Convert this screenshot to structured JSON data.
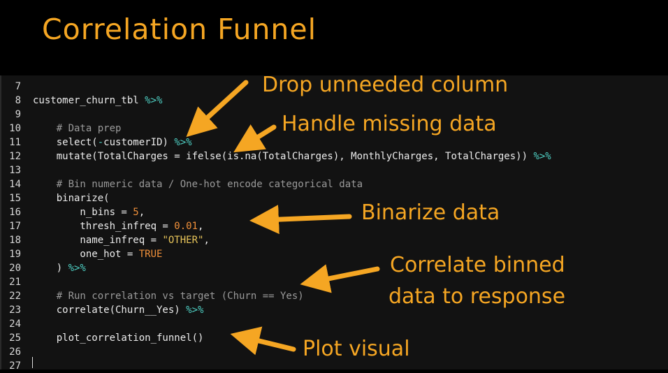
{
  "title": "Correlation Funnel",
  "code_lines": [
    {
      "n": "7",
      "seg": []
    },
    {
      "n": "8",
      "seg": [
        [
          "customer_churn_tbl ",
          ""
        ],
        [
          "%>%",
          "op"
        ]
      ]
    },
    {
      "n": "9",
      "seg": []
    },
    {
      "n": "10",
      "seg": [
        [
          "    # Data prep",
          "cm"
        ]
      ]
    },
    {
      "n": "11",
      "seg": [
        [
          "    select(",
          ""
        ],
        [
          "-",
          "op"
        ],
        [
          "customerID) ",
          ""
        ],
        [
          "%>%",
          "op"
        ]
      ]
    },
    {
      "n": "12",
      "seg": [
        [
          "    mutate(TotalCharges = ifelse(is.na(TotalCharges), MonthlyCharges, TotalCharges)) ",
          ""
        ],
        [
          "%>%",
          "op"
        ]
      ]
    },
    {
      "n": "13",
      "seg": []
    },
    {
      "n": "14",
      "seg": [
        [
          "    # Bin numeric data / One-hot encode categorical data",
          "cm"
        ]
      ]
    },
    {
      "n": "15",
      "seg": [
        [
          "    binarize(",
          ""
        ]
      ]
    },
    {
      "n": "16",
      "seg": [
        [
          "        n_bins = ",
          ""
        ],
        [
          "5",
          "num"
        ],
        [
          ",",
          ""
        ]
      ]
    },
    {
      "n": "17",
      "seg": [
        [
          "        thresh_infreq = ",
          ""
        ],
        [
          "0.01",
          "num"
        ],
        [
          ",",
          ""
        ]
      ]
    },
    {
      "n": "18",
      "seg": [
        [
          "        name_infreq = ",
          ""
        ],
        [
          "\"OTHER\"",
          "str"
        ],
        [
          ",",
          ""
        ]
      ]
    },
    {
      "n": "19",
      "seg": [
        [
          "        one_hot = ",
          ""
        ],
        [
          "TRUE",
          "kw"
        ]
      ]
    },
    {
      "n": "20",
      "seg": [
        [
          "    ) ",
          ""
        ],
        [
          "%>%",
          "op"
        ]
      ]
    },
    {
      "n": "21",
      "seg": []
    },
    {
      "n": "22",
      "seg": [
        [
          "    # Run correlation vs target (Churn == Yes)",
          "cm"
        ]
      ]
    },
    {
      "n": "23",
      "seg": [
        [
          "    correlate(Churn__Yes) ",
          ""
        ],
        [
          "%>%",
          "op"
        ]
      ]
    },
    {
      "n": "24",
      "seg": []
    },
    {
      "n": "25",
      "seg": [
        [
          "    plot_correlation_funnel()",
          ""
        ]
      ]
    },
    {
      "n": "26",
      "seg": []
    },
    {
      "n": "27",
      "seg": []
    }
  ],
  "annotations": {
    "drop": "Drop unneeded column",
    "missing": "Handle missing data",
    "binarize": "Binarize data",
    "correlate_1": "Correlate binned",
    "correlate_2": "data to response",
    "plot": "Plot visual"
  },
  "colors": {
    "accent": "#f5a623",
    "operator": "#4fd1c5",
    "comment": "#9a9a9a",
    "number": "#f0903a",
    "string": "#e8c55a"
  }
}
